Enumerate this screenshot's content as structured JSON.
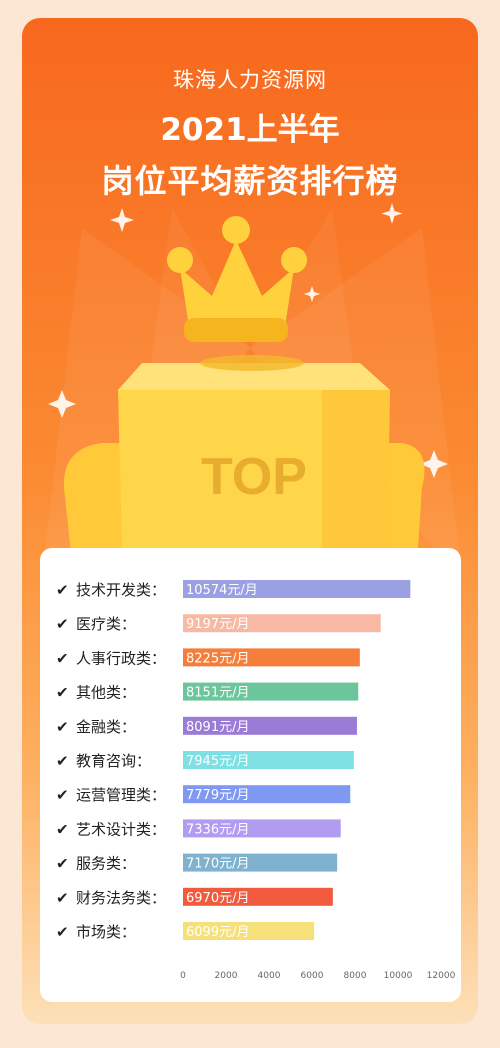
{
  "header": {
    "brand": "珠海人力资源网",
    "title_line1": "2021上半年",
    "title_line2": "岗位平均薪资排行榜"
  },
  "podium": {
    "label": "TOP"
  },
  "chart_data": {
    "type": "bar",
    "orientation": "horizontal",
    "categories": [
      "技术开发类：",
      "医疗类：",
      "人事行政类：",
      "其他类：",
      "金融类：",
      "教育咨询：",
      "运营管理类：",
      "艺术设计类：",
      "服务类：",
      "财务法务类：",
      "市场类："
    ],
    "values": [
      10574,
      9197,
      8225,
      8151,
      8091,
      7945,
      7779,
      7336,
      7170,
      6970,
      6099
    ],
    "value_labels": [
      "10574元/月",
      "9197元/月",
      "8225元/月",
      "8151元/月",
      "8091元/月",
      "7945元/月",
      "7779元/月",
      "7336元/月",
      "7170元/月",
      "6970元/月",
      "6099元/月"
    ],
    "colors": [
      "#9aa0e2",
      "#f7b9a4",
      "#f57f3a",
      "#6cc69b",
      "#9a7bd6",
      "#7fe0e3",
      "#7f99f2",
      "#b29cf2",
      "#7eb2cf",
      "#f15a3c",
      "#f6e07a"
    ],
    "xlim": [
      0,
      12000
    ],
    "xticks": [
      0,
      2000,
      4000,
      6000,
      8000,
      10000,
      12000
    ],
    "grid": false,
    "legend": "none"
  }
}
